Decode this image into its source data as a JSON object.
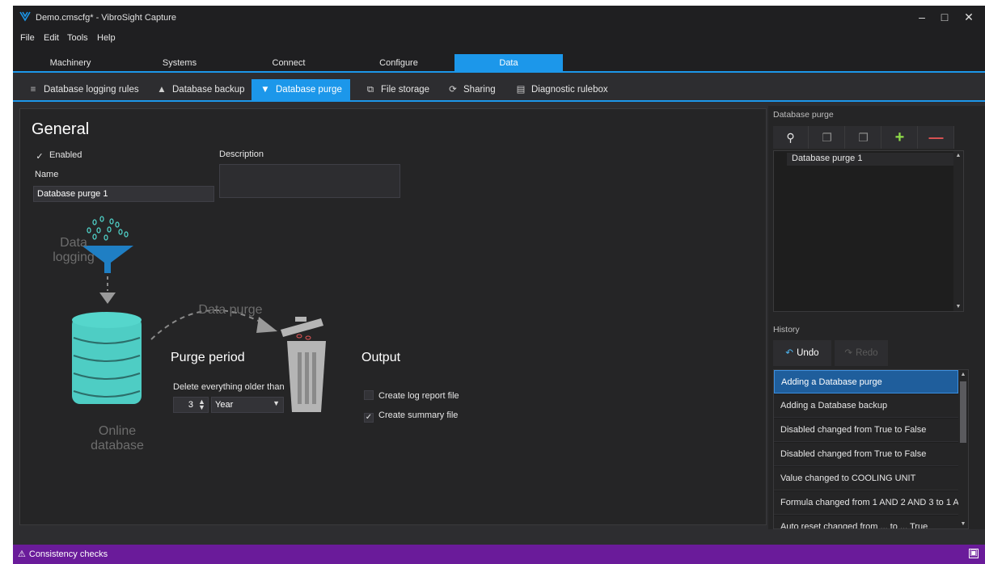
{
  "window": {
    "title": "Demo.cmscfg* - VibroSight Capture",
    "minimize": "‒",
    "maximize": "□",
    "close": "✕"
  },
  "menu": [
    "File",
    "Edit",
    "Tools",
    "Help"
  ],
  "main_tabs": [
    "Machinery",
    "Systems",
    "Connect",
    "Configure",
    "Data"
  ],
  "sub_tabs": [
    "Database logging rules",
    "Database backup",
    "Database purge",
    "File storage",
    "Sharing",
    "Diagnostic rulebox"
  ],
  "general": {
    "title": "General",
    "enabled_label": "Enabled",
    "enabled_check": "✓",
    "name_label": "Name",
    "name_value": "Database purge 1",
    "description_label": "Description",
    "description_value": ""
  },
  "diagram": {
    "data_logging_1": "Data",
    "data_logging_2": "logging",
    "data_purge": "Data purge",
    "online_db_1": "Online",
    "online_db_2": "database"
  },
  "purge_period": {
    "title": "Purge period",
    "delete_label": "Delete everything older than",
    "value": "3",
    "unit": "Year"
  },
  "output": {
    "title": "Output",
    "options": [
      {
        "label": "Create log report file",
        "checked": ""
      },
      {
        "label": "Create summary file",
        "checked": "✓"
      }
    ]
  },
  "purge_panel": {
    "label": "Database purge",
    "items": [
      "Database purge 1"
    ]
  },
  "history": {
    "label": "History",
    "undo": "Undo",
    "redo": "Redo",
    "rows": [
      "Adding a Database purge",
      "Adding a Database backup",
      "Disabled changed from True to False",
      "Disabled changed from True to False",
      "Value changed to COOLING UNIT",
      "Formula changed from 1 AND 2 AND 3 to 1 A",
      "Auto reset changed from ... to ... True"
    ]
  },
  "status": {
    "consistency": "Consistency checks"
  },
  "colors": {
    "accent": "#1c97ea",
    "status_bar": "#6a1b9a",
    "diagram_teal": "#4ecdc4"
  }
}
